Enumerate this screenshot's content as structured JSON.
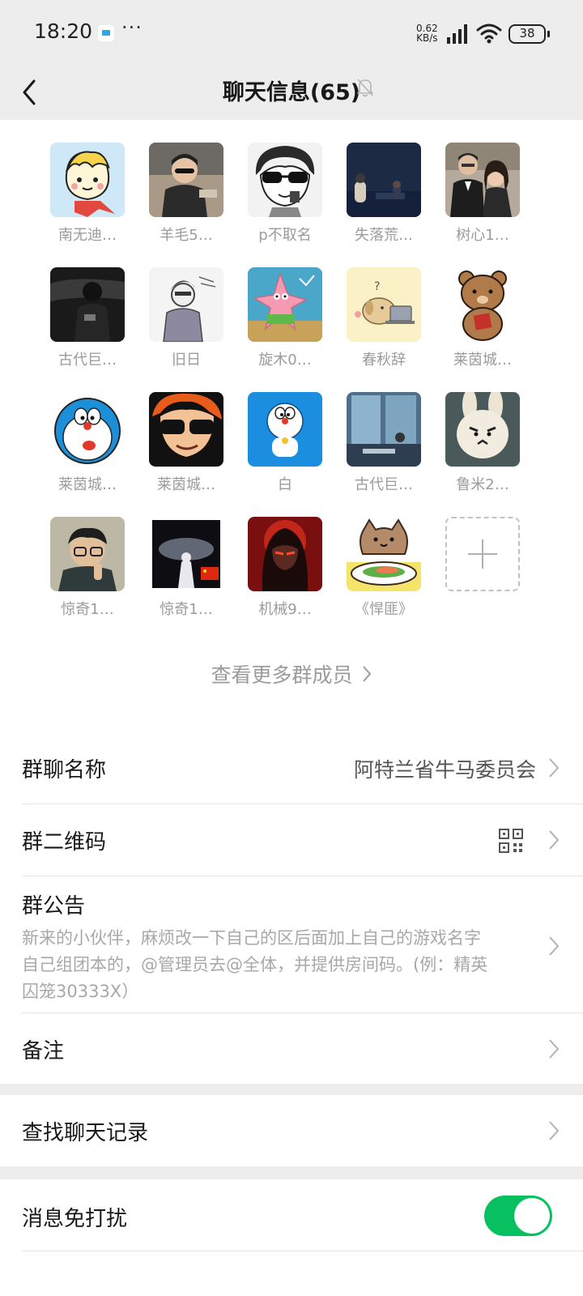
{
  "status_bar": {
    "time": "18:20",
    "more": "···",
    "speed_value": "0.62",
    "speed_unit": "KB/s",
    "battery": "38"
  },
  "header": {
    "title": "聊天信息(65)"
  },
  "members": [
    {
      "name": "南无迪…",
      "avatar": "cartoon-boy-avatar"
    },
    {
      "name": "羊毛5…",
      "avatar": "boy-sunglasses-avatar"
    },
    {
      "name": "p不取名",
      "avatar": "anime-sunglasses-avatar"
    },
    {
      "name": "失落荒…",
      "avatar": "night-scene-avatar"
    },
    {
      "name": "树心1…",
      "avatar": "couple-photo-avatar"
    },
    {
      "name": "古代巨…",
      "avatar": "car-interior-avatar"
    },
    {
      "name": "旧日",
      "avatar": "sketch-man-avatar"
    },
    {
      "name": "旋木0…",
      "avatar": "patrick-star-avatar"
    },
    {
      "name": "春秋辞",
      "avatar": "puppy-laptop-avatar"
    },
    {
      "name": "莱茵城…",
      "avatar": "teddy-bear-avatar"
    },
    {
      "name": "莱茵城…",
      "avatar": "doraemon-avatar"
    },
    {
      "name": "莱茵城…",
      "avatar": "cartoon-sunglasses-avatar"
    },
    {
      "name": "白",
      "avatar": "doraemon-blue-avatar"
    },
    {
      "name": "古代巨…",
      "avatar": "cafe-window-avatar"
    },
    {
      "name": "鲁米2…",
      "avatar": "rabbit-plush-avatar"
    },
    {
      "name": "惊奇1…",
      "avatar": "glasses-man-avatar"
    },
    {
      "name": "惊奇1…",
      "avatar": "galaxy-figure-avatar"
    },
    {
      "name": "机械9…",
      "avatar": "red-hero-avatar"
    },
    {
      "name": "《悍匪》",
      "avatar": "cat-sushi-avatar"
    }
  ],
  "more_members": "查看更多群成员",
  "settings": {
    "group_name_label": "群聊名称",
    "group_name_value": "阿特兰省牛马委员会",
    "qr_label": "群二维码",
    "notice_label": "群公告",
    "notice_line1": "新来的小伙伴，麻烦改一下自己的区后面加上自己的游戏名字",
    "notice_line2": "自己组团本的，@管理员去@全体，并提供房间码。(例：精英",
    "notice_line3": "囚笼30333X）",
    "remark_label": "备注",
    "search_label": "查找聊天记录",
    "dnd_label": "消息免打扰",
    "dnd_on": true
  },
  "colors": {
    "accent_green": "#07c160",
    "background": "#ededed"
  }
}
